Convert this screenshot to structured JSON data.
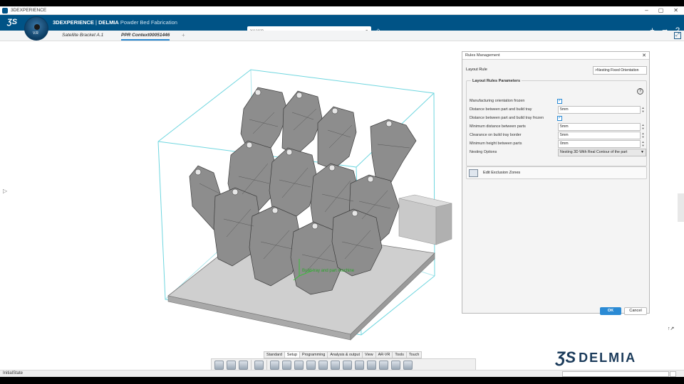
{
  "window": {
    "title": "3DEXPERIENCE",
    "controls": [
      "–",
      "▢",
      "✕"
    ]
  },
  "header": {
    "brand_bold": "3DEXPERIENCE",
    "brand_sep": " | ",
    "brand_app": "DELMIA",
    "brand_product": "Powder Bed Fabrication",
    "compass_version": "V.R",
    "search_placeholder": "Search"
  },
  "tabs": [
    {
      "label": "Satellite Bracket A.1",
      "active": false
    },
    {
      "label": "PPR Context00051446",
      "active": true
    }
  ],
  "viewport": {
    "annotation": "Build tray and part machine"
  },
  "rules_panel": {
    "title": "Rules Management",
    "layout_rule_label": "Layout Rule",
    "layout_rule_value": ">Nesting Fixed Orientation",
    "group_title": "Layout Rules Parameters",
    "params": [
      {
        "label": "Manufacturing orientation frozen",
        "type": "checkbox",
        "checked": true
      },
      {
        "label": "Distance between part and build tray",
        "type": "field",
        "value": "5mm"
      },
      {
        "label": "Distance between part and build tray frozen",
        "type": "checkbox",
        "checked": true
      },
      {
        "label": "Minimum distance between parts",
        "type": "field",
        "value": "5mm"
      },
      {
        "label": "Clearance on build tray border",
        "type": "field",
        "value": "5mm"
      },
      {
        "label": "Minimum height between parts",
        "type": "field",
        "value": "0mm"
      },
      {
        "label": "Nesting Options",
        "type": "select",
        "value": "Nesting 3D With Real Contour of the part"
      }
    ],
    "exclusion_label": "Edit Exclusion Zones",
    "ok_label": "OK",
    "cancel_label": "Cancel"
  },
  "action_bar": {
    "tabs": [
      "Standard",
      "Setup",
      "Programming",
      "Analysis & output",
      "View",
      "AR-VR",
      "Tools",
      "Touch"
    ],
    "active_tab": "Setup"
  },
  "brand_logo": {
    "text": "DELMIA"
  },
  "status": {
    "text": "InitialState"
  },
  "colors": {
    "header": "#005386",
    "accent": "#2a8ad4",
    "bbox": "#6fd6df"
  }
}
